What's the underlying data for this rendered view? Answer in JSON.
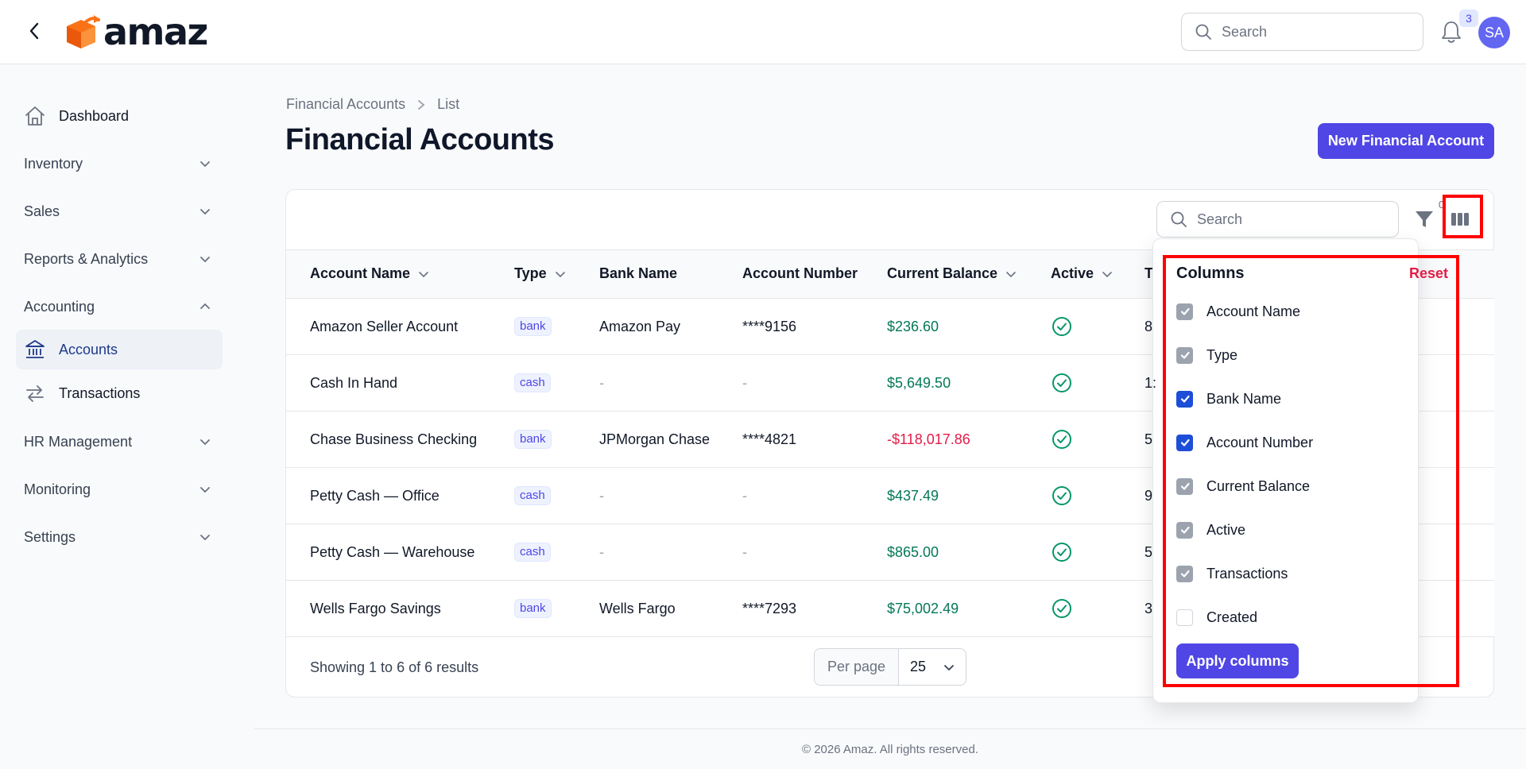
{
  "header": {
    "logo_text": "amaz",
    "search_placeholder": "Search",
    "notification_count": "3",
    "avatar_initials": "SA"
  },
  "sidebar": {
    "items": [
      {
        "label": "Dashboard",
        "icon": "home-icon"
      },
      {
        "label": "Inventory",
        "expanded": false
      },
      {
        "label": "Sales",
        "expanded": false
      },
      {
        "label": "Reports & Analytics",
        "expanded": false
      },
      {
        "label": "Accounting",
        "expanded": true
      },
      {
        "label": "Accounts",
        "icon": "bank-icon",
        "active": true
      },
      {
        "label": "Transactions",
        "icon": "arrows-swap-icon"
      },
      {
        "label": "HR Management",
        "expanded": false
      },
      {
        "label": "Monitoring",
        "expanded": false
      },
      {
        "label": "Settings",
        "expanded": false
      }
    ]
  },
  "breadcrumb": [
    "Financial Accounts",
    "List"
  ],
  "page_title": "Financial Accounts",
  "new_button_label": "New Financial Account",
  "table": {
    "search_placeholder": "Search",
    "filter_count": "0",
    "columns": [
      "Account Name",
      "Type",
      "Bank Name",
      "Account Number",
      "Current Balance",
      "Active",
      "T"
    ],
    "rows": [
      {
        "name": "Amazon Seller Account",
        "type": "bank",
        "bank": "Amazon Pay",
        "number": "****9156",
        "balance": "$236.60",
        "active": true,
        "t": "8"
      },
      {
        "name": "Cash In Hand",
        "type": "cash",
        "bank": "-",
        "number": "-",
        "balance": "$5,649.50",
        "active": true,
        "t": "1:"
      },
      {
        "name": "Chase Business Checking",
        "type": "bank",
        "bank": "JPMorgan Chase",
        "number": "****4821",
        "balance": "-$118,017.86",
        "active": true,
        "t": "5"
      },
      {
        "name": "Petty Cash — Office",
        "type": "cash",
        "bank": "-",
        "number": "-",
        "balance": "$437.49",
        "active": true,
        "t": "9"
      },
      {
        "name": "Petty Cash — Warehouse",
        "type": "cash",
        "bank": "-",
        "number": "-",
        "balance": "$865.00",
        "active": true,
        "t": "5"
      },
      {
        "name": "Wells Fargo Savings",
        "type": "bank",
        "bank": "Wells Fargo",
        "number": "****7293",
        "balance": "$75,002.49",
        "active": true,
        "t": "3"
      }
    ],
    "showing_text": "Showing 1 to 6 of 6 results",
    "per_page_label": "Per page",
    "per_page_value": "25"
  },
  "columns_panel": {
    "title": "Columns",
    "reset_label": "Reset",
    "options": [
      {
        "label": "Account Name",
        "state": "checked-disabled"
      },
      {
        "label": "Type",
        "state": "checked-disabled"
      },
      {
        "label": "Bank Name",
        "state": "checked"
      },
      {
        "label": "Account Number",
        "state": "checked"
      },
      {
        "label": "Current Balance",
        "state": "checked-disabled"
      },
      {
        "label": "Active",
        "state": "checked-disabled"
      },
      {
        "label": "Transactions",
        "state": "checked-disabled"
      },
      {
        "label": "Created",
        "state": "unchecked"
      }
    ],
    "apply_label": "Apply columns"
  },
  "footer": "© 2026 Amaz. All rights reserved.",
  "colors": {
    "accent": "#4f46e5",
    "positive": "#047857",
    "negative": "#e11d48",
    "highlight": "#ff0000"
  }
}
